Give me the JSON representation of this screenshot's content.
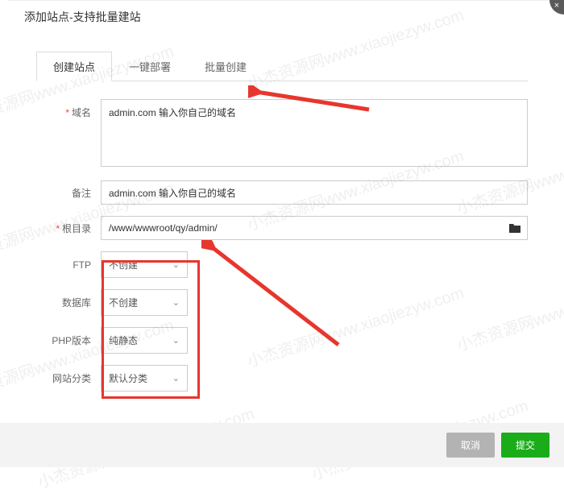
{
  "title": "添加站点-支持批量建站",
  "tabs": {
    "t0": "创建站点",
    "t1": "一键部署",
    "t2": "批量创建"
  },
  "labels": {
    "domain": "域名",
    "remark": "备注",
    "root": "根目录",
    "ftp": "FTP",
    "db": "数据库",
    "php": "PHP版本",
    "cat": "网站分类"
  },
  "values": {
    "domain": "admin.com 输入你自己的域名",
    "remark": "admin.com 输入你自己的域名",
    "root": "/www/wwwroot/qy/admin/",
    "ftp": "不创建",
    "db": "不创建",
    "php": "纯静态",
    "cat": "默认分类"
  },
  "buttons": {
    "cancel": "取消",
    "submit": "提交"
  },
  "watermark": "小杰资源网www.xiaojiezyw.com"
}
